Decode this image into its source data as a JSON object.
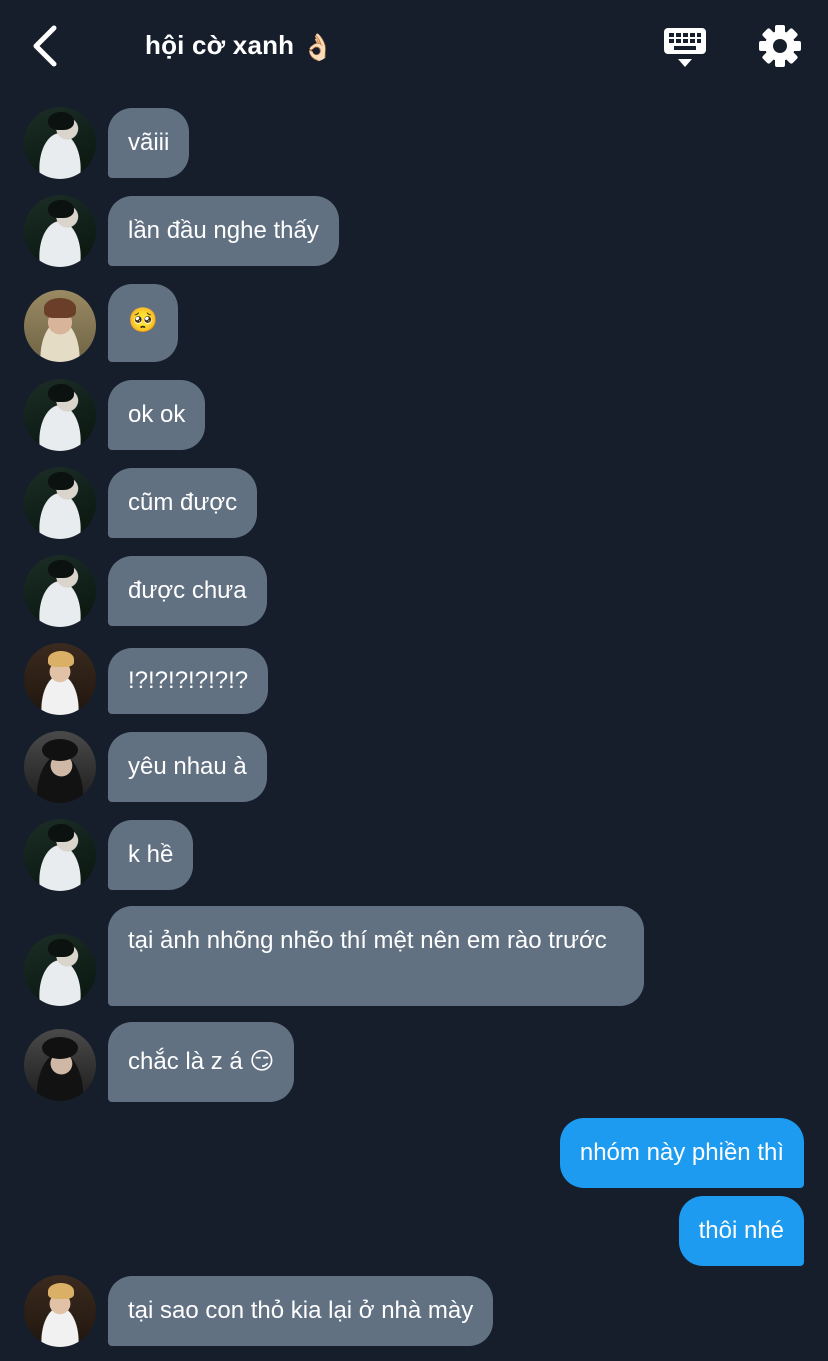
{
  "header": {
    "title": "hội cờ xanh",
    "title_emoji": "👌🏻"
  },
  "icons": {
    "back": "chevron-left-icon",
    "keyboard": "keyboard-icon",
    "settings": "gear-icon"
  },
  "colors": {
    "background": "#161e2b",
    "incoming_bubble": "#627182",
    "outgoing_bubble": "#1d9bf0",
    "text": "#ffffff"
  },
  "messages": [
    {
      "sender": "member-a",
      "text": "vãiii"
    },
    {
      "sender": "member-a",
      "text": "lần đầu nghe thấy"
    },
    {
      "sender": "member-b",
      "text": "🥺"
    },
    {
      "sender": "member-a",
      "text": "ok ok"
    },
    {
      "sender": "member-a",
      "text": "cũm được"
    },
    {
      "sender": "member-a",
      "text": "được chưa"
    },
    {
      "sender": "member-c",
      "text": "!?!?!?!?!?!?"
    },
    {
      "sender": "member-d",
      "text": "yêu nhau à"
    },
    {
      "sender": "member-a",
      "text": "k hề"
    },
    {
      "sender": "member-a",
      "text": "tại ảnh nhõng nhẽo thí mệt nên em rào trước"
    },
    {
      "sender": "member-d",
      "text": "chắc là z á 😏"
    },
    {
      "sender": "me",
      "text": "nhóm này phiền thì"
    },
    {
      "sender": "me",
      "text": "thôi nhé"
    },
    {
      "sender": "member-c",
      "text": "tại sao con thỏ kia lại ở nhà mày"
    }
  ]
}
